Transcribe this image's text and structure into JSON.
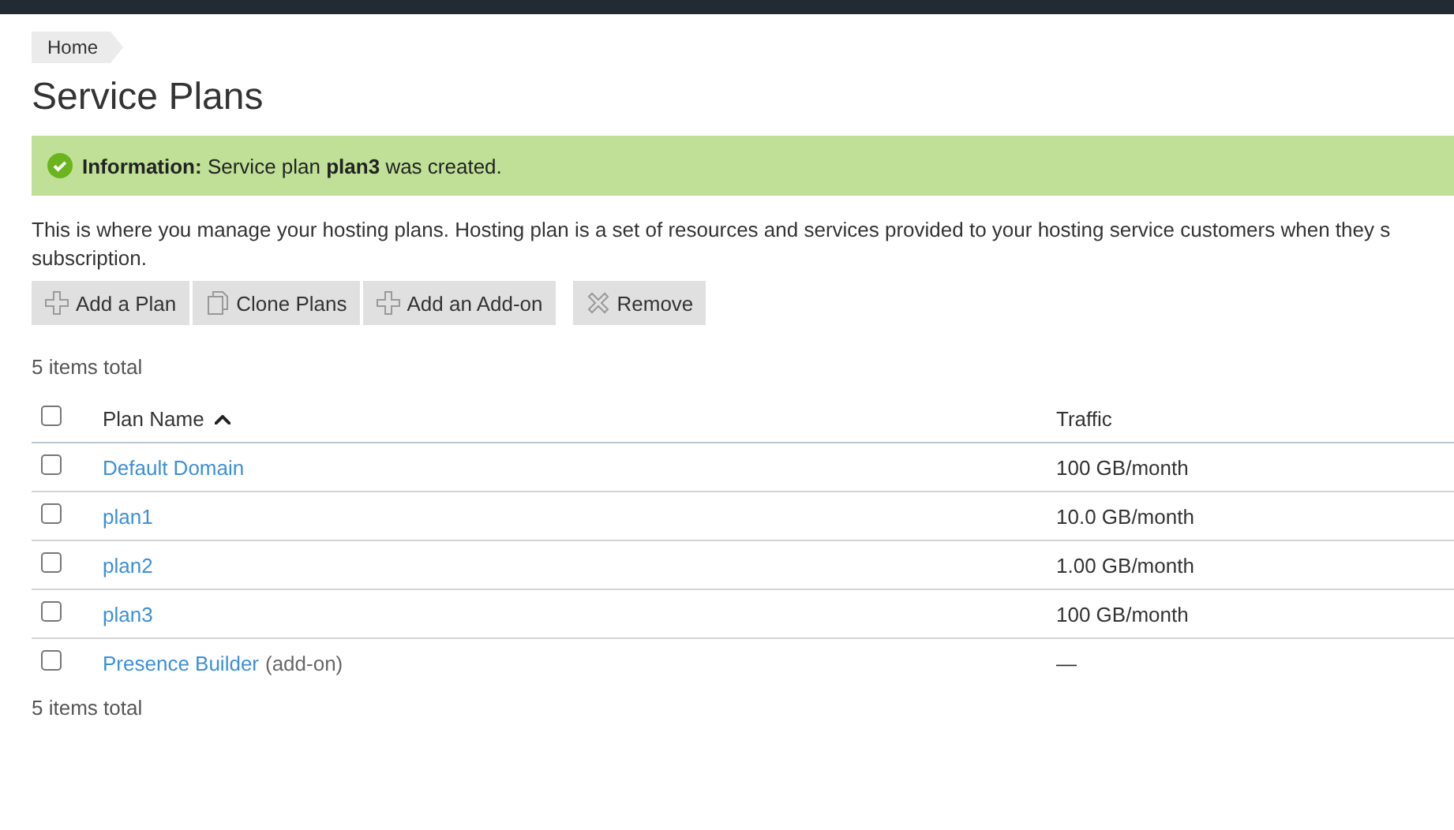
{
  "breadcrumb": [
    "Home"
  ],
  "title": "Service Plans",
  "message": {
    "label": "Information:",
    "text": "Service plan **plan3** was created."
  },
  "description_lines": [
    "This is where you manage your hosting plans. Hosting plan is a set of resources and services provided to your hosting service customers when they s",
    "subscription."
  ],
  "toolbar": [
    {
      "label": "Add a Plan",
      "kind": "add"
    },
    {
      "label": "Clone Plans",
      "kind": "clone"
    },
    {
      "label": "Add an Add-on",
      "kind": "add"
    },
    {
      "label": "Remove",
      "kind": "remove"
    }
  ],
  "total_top": "5 items total",
  "table": {
    "select_all_checked": false,
    "columns": [
      {
        "label": "Plan Name",
        "sorted": true
      },
      {
        "label": "Traffic",
        "sorted": false
      }
    ],
    "rows": [
      {
        "name": "Default Domain",
        "suffix": null,
        "traffic": "100 GB/month",
        "checked": false
      },
      {
        "name": "plan1",
        "suffix": null,
        "traffic": "10.0 GB/month",
        "checked": false
      },
      {
        "name": "plan2",
        "suffix": null,
        "traffic": "1.00 GB/month",
        "checked": false
      },
      {
        "name": "plan3",
        "suffix": null,
        "traffic": "100 GB/month",
        "checked": false
      },
      {
        "name": "Presence Builder",
        "suffix": "(add-on)",
        "traffic": "—",
        "checked": false
      }
    ]
  },
  "total_bottom": "5 items total"
}
